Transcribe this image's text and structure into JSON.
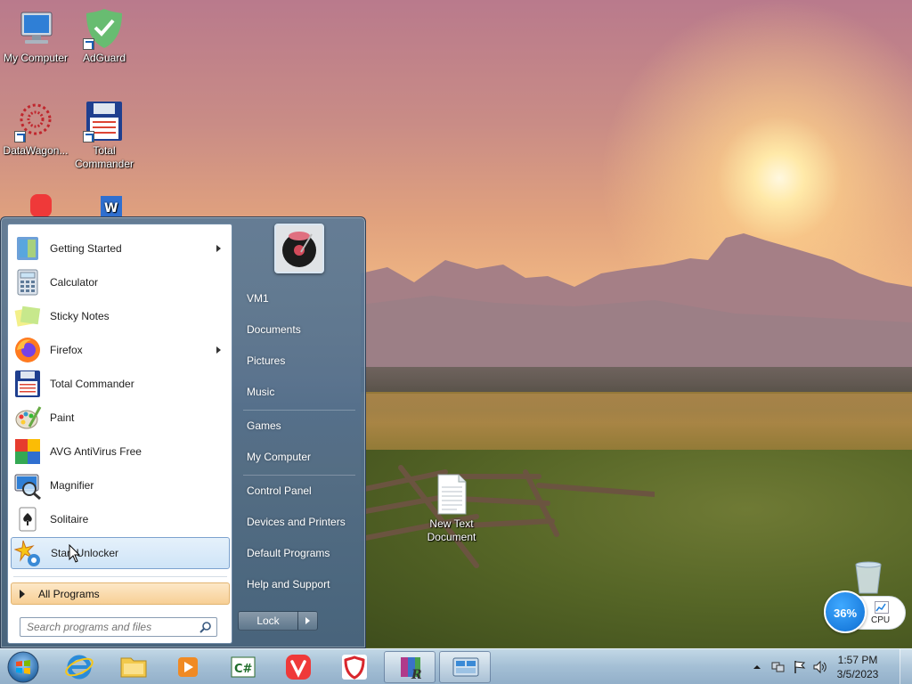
{
  "desktop": {
    "icons": [
      {
        "label": "My Computer",
        "icon": "computer-icon"
      },
      {
        "label": "AdGuard",
        "icon": "adguard-icon"
      },
      {
        "label": "DataWagon...",
        "icon": "datawagon-icon"
      },
      {
        "label": "Total Commander",
        "icon": "total-commander-icon"
      },
      {
        "label": "Vivaldi",
        "icon": "vivaldi-icon"
      },
      {
        "label": "WinTools",
        "icon": "wintools-icon"
      },
      {
        "label": "New Text Document",
        "icon": "text-document-icon"
      },
      {
        "label": "Recycle Bin",
        "icon": "recycle-bin-icon"
      }
    ]
  },
  "start_menu": {
    "programs": [
      {
        "label": "Getting Started",
        "icon": "getting-started-icon",
        "has_submenu": true
      },
      {
        "label": "Calculator",
        "icon": "calculator-icon",
        "has_submenu": false
      },
      {
        "label": "Sticky Notes",
        "icon": "sticky-notes-icon",
        "has_submenu": false
      },
      {
        "label": "Firefox",
        "icon": "firefox-icon",
        "has_submenu": true
      },
      {
        "label": "Total Commander",
        "icon": "total-commander-icon",
        "has_submenu": false
      },
      {
        "label": "Paint",
        "icon": "paint-icon",
        "has_submenu": false
      },
      {
        "label": "AVG AntiVirus Free",
        "icon": "avg-icon",
        "has_submenu": false
      },
      {
        "label": "Magnifier",
        "icon": "magnifier-icon",
        "has_submenu": false
      },
      {
        "label": "Solitaire",
        "icon": "solitaire-icon",
        "has_submenu": false
      },
      {
        "label": "Start Unlocker",
        "icon": "start-unlocker-icon",
        "has_submenu": false,
        "highlighted": true
      }
    ],
    "all_programs_label": "All Programs",
    "search_placeholder": "Search programs and files",
    "user_items": {
      "user": "VM1",
      "documents": "Documents",
      "pictures": "Pictures",
      "music": "Music",
      "games": "Games",
      "my_computer": "My Computer",
      "control_panel": "Control Panel",
      "devices_printers": "Devices and Printers",
      "default_programs": "Default Programs",
      "help_support": "Help and Support"
    },
    "lock_label": "Lock"
  },
  "taskbar": {
    "pinned": [
      "internet-explorer-icon",
      "file-explorer-icon",
      "media-player-icon",
      "csharp-editor-icon",
      "vivaldi-icon",
      "adguard-icon",
      "winrar-icon",
      "remote-desktop-icon"
    ],
    "clock_time": "1:57 PM",
    "clock_date": "3/5/2023"
  },
  "cpu_gadget": {
    "percent": "36%",
    "label": "CPU"
  },
  "colors": {
    "taskbar": "#a8c4de",
    "all_programs": "#f7cf95",
    "highlight": "#cfe4f7",
    "cpu_blue": "#1c7fe0"
  }
}
